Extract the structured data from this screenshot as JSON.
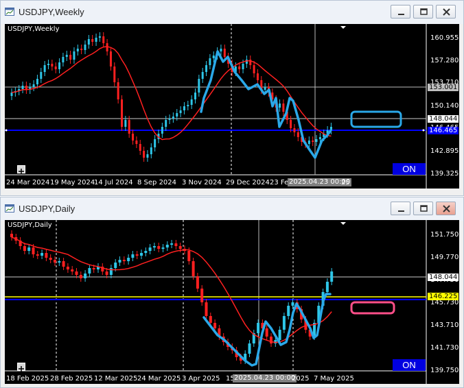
{
  "weekly": {
    "title": "USDJPY,Weekly",
    "chart_label": "USDJPY,Weekly",
    "price_ticks": [
      "160.955",
      "157.280",
      "153.710",
      "150.140",
      "146.465",
      "142.895",
      "139.325"
    ],
    "current_price": "148.044",
    "hline_price": "153.001",
    "blue_price": "146.465",
    "date_ticks": [
      "24 Mar 2024",
      "19 May 2024",
      "14 Jul 2024",
      "8 Sep 2024",
      "3 Nov 2024",
      "29 Dec 2024",
      "23 Fe",
      "25"
    ],
    "crosshair_date": "2025.04.23 00:00",
    "on_label": "ON",
    "colors": {
      "bull": "#2ec6e8",
      "bear": "#ff2020",
      "ma": "#ff2020",
      "drawing": "#2aa8e8",
      "blue_line": "#0000ff"
    }
  },
  "daily": {
    "title": "USDJPY,Daily",
    "chart_label": "USDJPY,Daily",
    "price_ticks": [
      "151.750",
      "149.770",
      "147.750",
      "145.730",
      "143.710",
      "141.730",
      "139.750"
    ],
    "current_price": "148.044",
    "yellow_price": "146.225",
    "date_ticks": [
      "18 Feb 2025",
      "28 Feb 2025",
      "12 Mar 2025",
      "24 Mar 2025",
      "3 Apr 2025",
      "15",
      "2025",
      "7 May 2025"
    ],
    "crosshair_date": "2025.04.23 00:00",
    "on_label": "ON",
    "colors": {
      "bull": "#2ec6e8",
      "bear": "#ff2020",
      "ma": "#ff2020",
      "drawing": "#2aa8e8",
      "yellow_line": "#ffff00",
      "pink_box": "#ff4f8a"
    }
  }
}
